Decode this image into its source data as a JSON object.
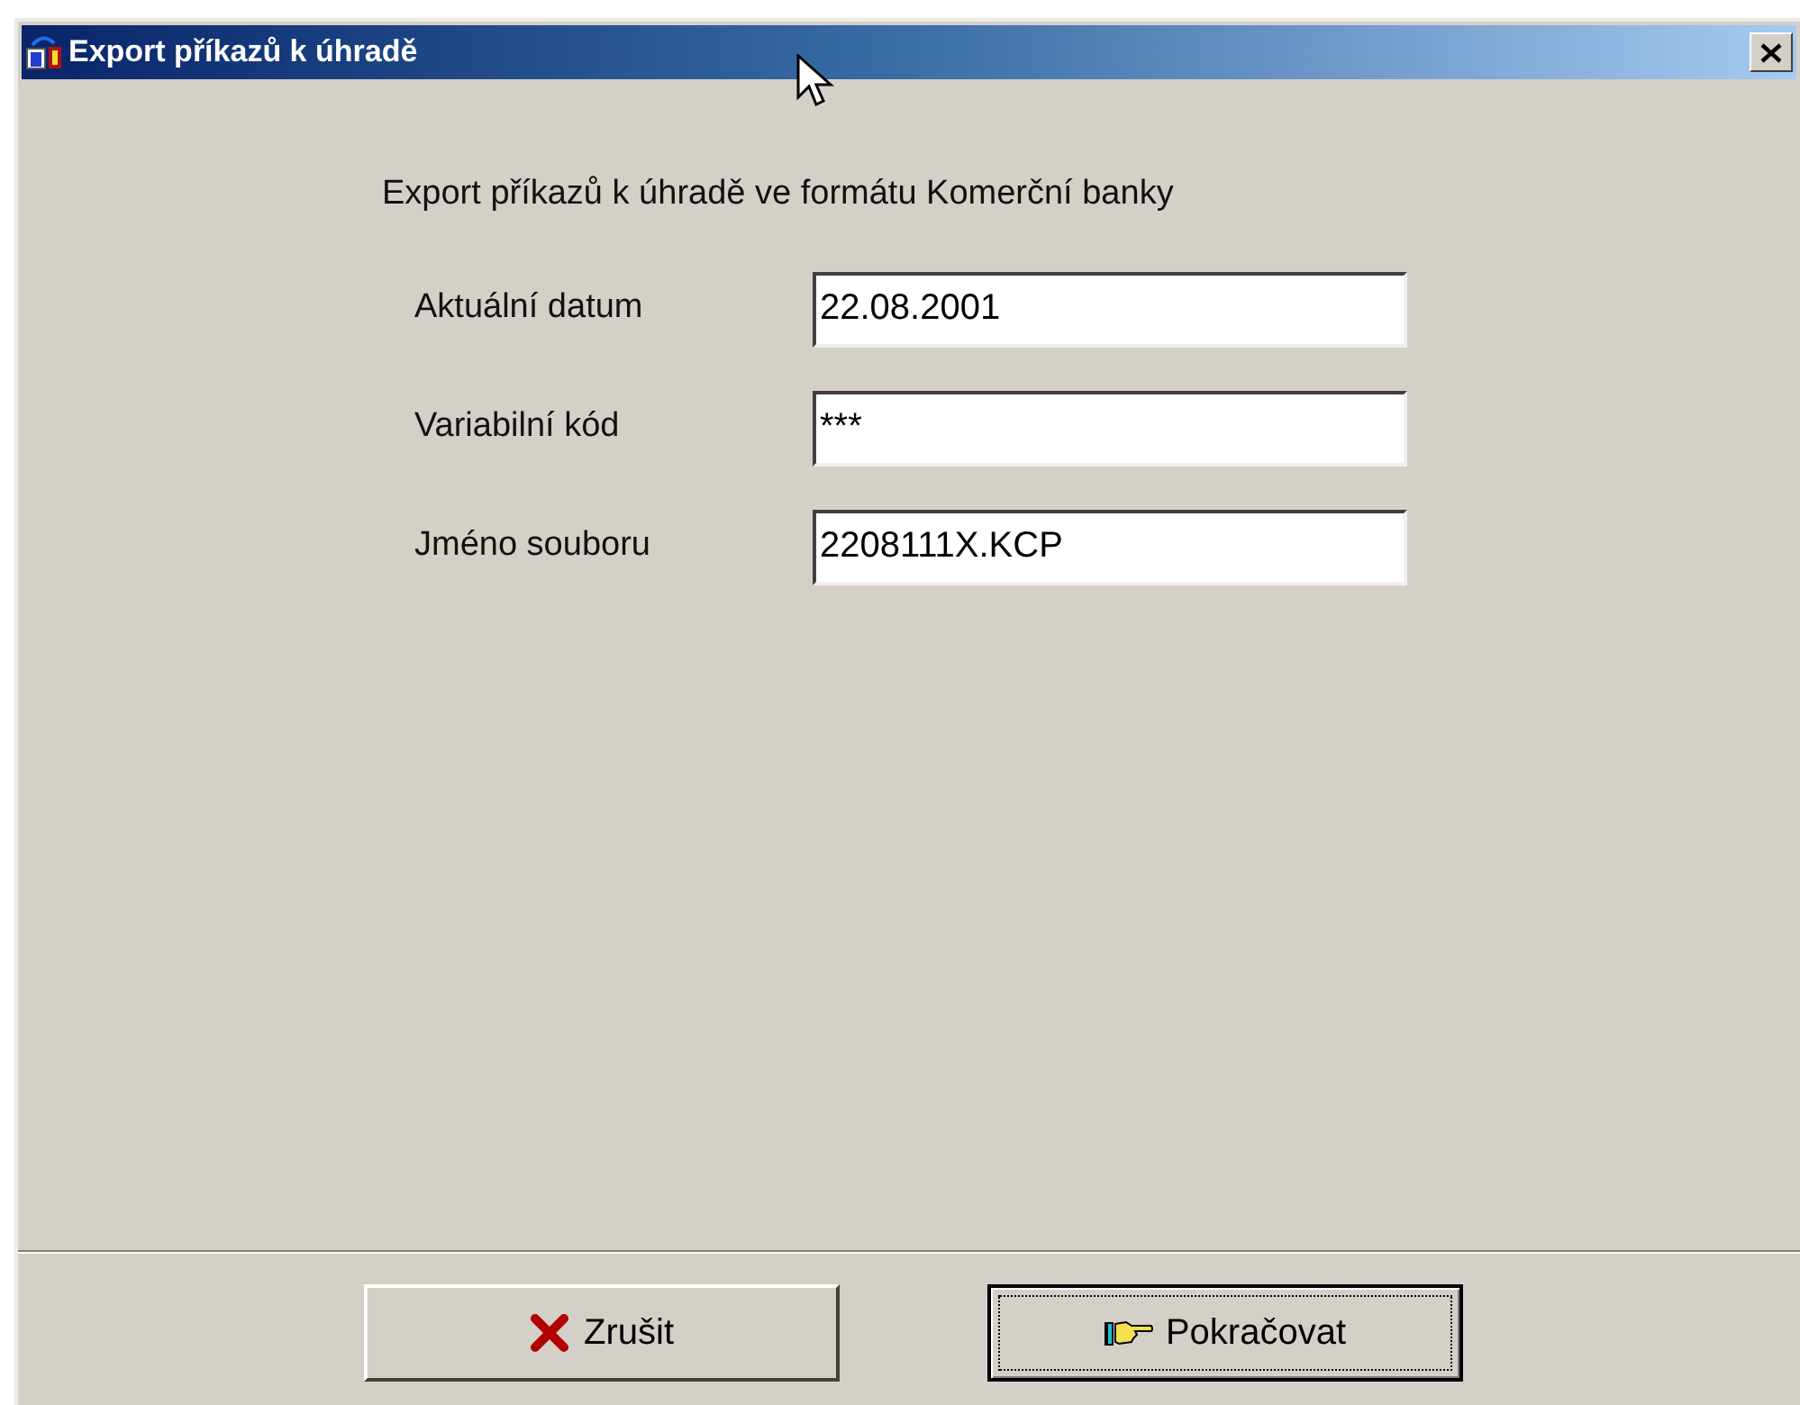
{
  "window": {
    "title": "Export příkazů k úhradě"
  },
  "heading": "Export příkazů k úhradě ve formátu Komerční banky",
  "fields": [
    {
      "label": "Aktuální datum",
      "value": "22.08.2001"
    },
    {
      "label": "Variabilní kód",
      "value": "***"
    },
    {
      "label": "Jméno souboru",
      "value": "2208111X.KCP"
    }
  ],
  "buttons": [
    {
      "kind": "cancel",
      "label": "Zrušit",
      "default": false
    },
    {
      "kind": "proceed",
      "label": "Pokračovat",
      "default": true
    }
  ]
}
